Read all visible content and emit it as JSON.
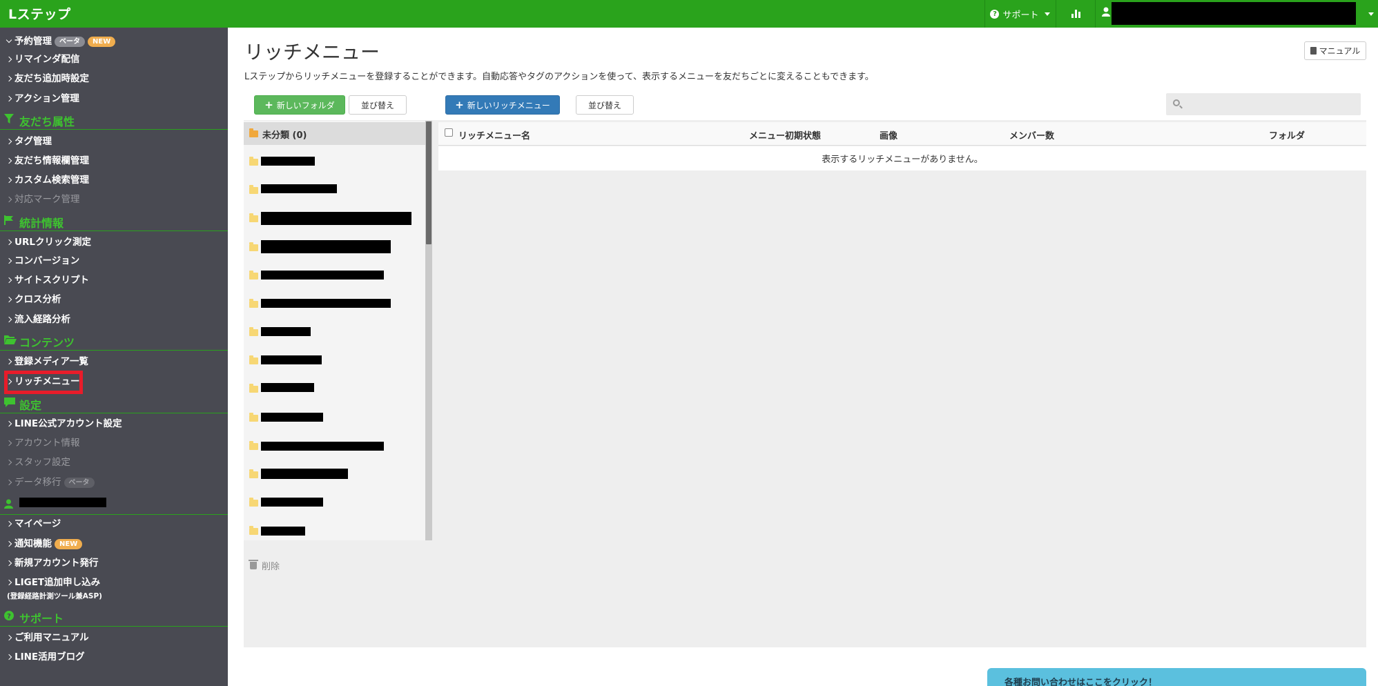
{
  "header": {
    "logo": "Lステップ",
    "support_label": "サポート"
  },
  "sidebar": {
    "items": {
      "reservation": "予約管理",
      "reservation_badge_beta": "ベータ",
      "reservation_badge_new": "NEW",
      "reminder": "リマインダ配信",
      "friend_add": "友だち追加時設定",
      "action": "アクション管理",
      "tag": "タグ管理",
      "friend_info": "友だち情報欄管理",
      "custom_search": "カスタム検索管理",
      "mark": "対応マーク管理",
      "url_click": "URLクリック測定",
      "conversion": "コンバージョン",
      "site_script": "サイトスクリプト",
      "cross": "クロス分析",
      "inflow": "流入経路分析",
      "media": "登録メディア一覧",
      "rich_menu": "リッチメニュー",
      "line_account": "LINE公式アカウント設定",
      "account_info": "アカウント情報",
      "staff": "スタッフ設定",
      "data_migration": "データ移行",
      "data_migration_badge": "ベータ",
      "mypage": "マイページ",
      "notification": "通知機能",
      "notification_badge": "NEW",
      "new_account": "新規アカウント発行",
      "liget": "LIGET追加申し込み",
      "liget_note": "(登録経路計測ツール兼ASP)",
      "manual": "ご利用マニュアル",
      "blog": "LINE活用ブログ"
    },
    "sections": {
      "friend_attr": "友だち属性",
      "stats": "統計情報",
      "contents": "コンテンツ",
      "settings": "設定",
      "support": "サポート"
    }
  },
  "main": {
    "title": "リッチメニュー",
    "description": "Lステップからリッチメニューを登録することができます。自動応答やタグのアクションを使って、表示するメニューを友だちごとに変えることもできます。",
    "manual_button": "マニュアル",
    "new_folder_button": "新しいフォルダ",
    "sort_folder_button": "並び替え",
    "new_richmenu_button": "新しいリッチメニュー",
    "sort_richmenu_button": "並び替え",
    "search_placeholder": "",
    "folder_uncategorized": "未分類 (0)",
    "delete_label": "削除",
    "table": {
      "col_name": "リッチメニュー名",
      "col_initial": "メニュー初期状態",
      "col_image": "画像",
      "col_members": "メンバー数",
      "col_folder": "フォルダ",
      "empty": "表示するリッチメニューがありません。"
    },
    "contact_tab": "各種お問い合わせはここをクリック！"
  },
  "colors": {
    "brand_green": "#2aa31c",
    "sidebar_bg": "#494a52",
    "highlight_red": "#e81c2a",
    "primary_blue": "#337ab7",
    "success_green": "#5cb85c"
  }
}
